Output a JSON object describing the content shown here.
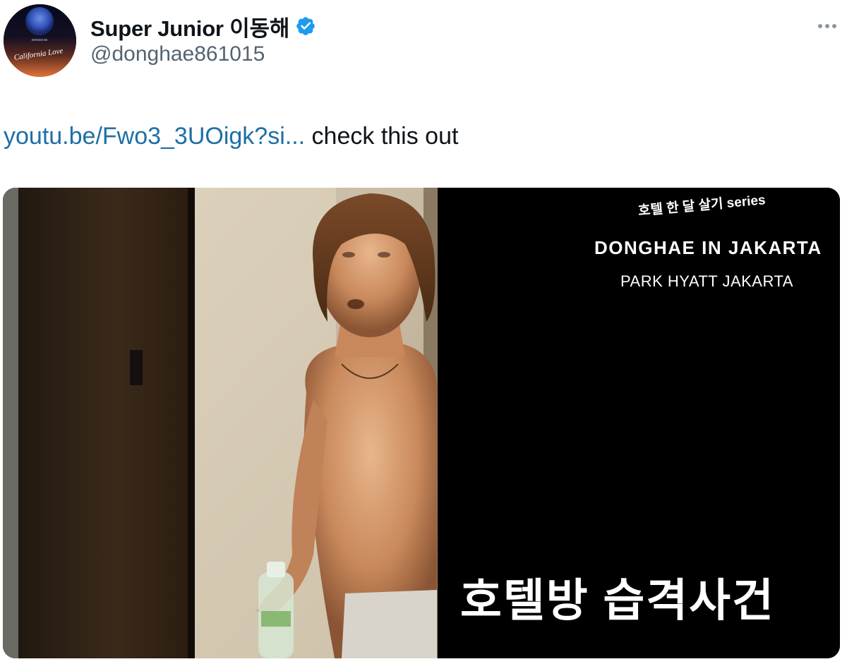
{
  "author": {
    "display_name": "Super Junior 이동해",
    "handle": "@donghae861015",
    "verified": true,
    "avatar_text_top": "DONGHAE",
    "avatar_text_script": "California Love"
  },
  "header": {
    "more_icon": "more-horizontal-icon"
  },
  "tweet": {
    "link_text": "youtu.be/Fwo3_3UOigk?si...",
    "text": " check this out"
  },
  "media": {
    "series_small": "호텔 한 달 살기 series",
    "headline_en": "DONGHAE IN JAKARTA",
    "subline_en": "PARK HYATT JAKARTA",
    "headline_ko": "호텔방 습격사건"
  },
  "colors": {
    "link": "#1d6fa5",
    "verified": "#1d9bf0",
    "handle": "#536471",
    "text": "#0f1419"
  }
}
